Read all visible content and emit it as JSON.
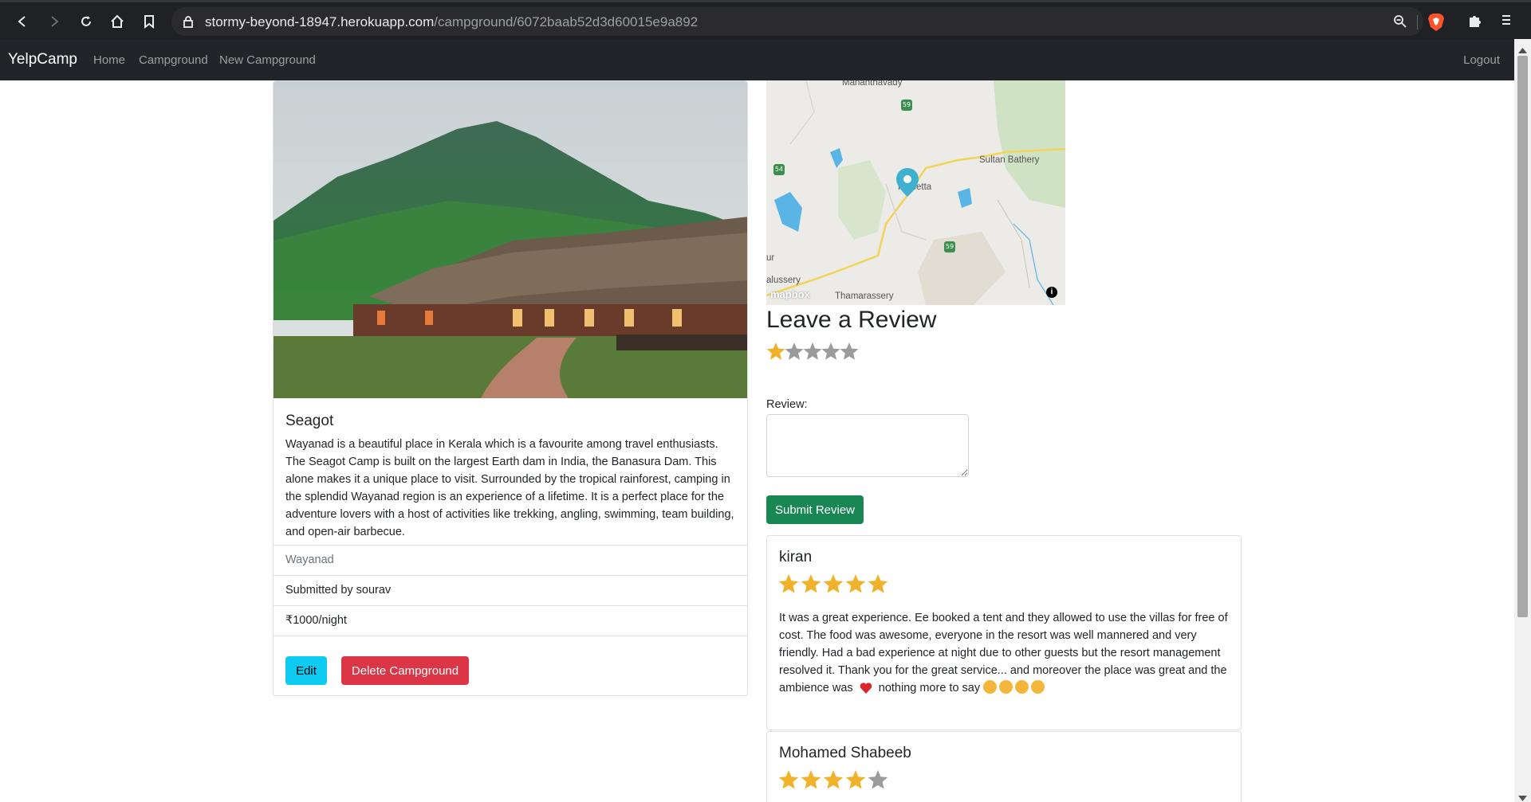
{
  "browser": {
    "url_host": "stormy-beyond-18947.herokuapp.com",
    "url_path": "/campground/6072baab52d3d60015e9a892"
  },
  "navbar": {
    "brand": "YelpCamp",
    "links": [
      "Home",
      "Campground",
      "New Campground"
    ],
    "logout": "Logout"
  },
  "campground": {
    "title": "Seagot",
    "description": "Wayanad is a beautiful place in Kerala which is a favourite among travel enthusiasts. The Seagot Camp is built on the largest Earth dam in India, the Banasura Dam. This alone makes it a unique place to visit. Surrounded by the tropical rainforest, camping in the splendid Wayanad region is an experience of a lifetime. It is a perfect place for the adventure lovers with a host of activities like trekking, angling, swimming, team building, and open-air barbecue.",
    "location": "Wayanad",
    "submitted_by": "Submitted by sourav",
    "price": "₹1000/night",
    "edit_label": "Edit",
    "delete_label": "Delete Campground"
  },
  "map": {
    "labels": [
      "Mananthavady",
      "Sultan Bathery",
      "Kalpetta",
      "ur",
      "alussery",
      "Thamarassery"
    ],
    "attribution": "mapbox",
    "route_shields": [
      "59",
      "54",
      "59"
    ]
  },
  "review_form": {
    "title": "Leave a Review",
    "selected_rating": 1,
    "max_rating": 5,
    "label": "Review:",
    "submit_label": "Submit Review"
  },
  "reviews": [
    {
      "author": "kiran",
      "rating": 5,
      "body_main": "It was a great experience. Ee booked a tent and they allowed to use the villas for free of cost. The food was awesome, everyone in the resort was well mannered and very friendly. Had a bad experience at night due to other guests but the resort management resolved it. Thank you for the great service... and moreover the place was great and the ambience was",
      "body_tail": "nothing more to say"
    },
    {
      "author": "Mohamed Shabeeb",
      "rating": 4
    }
  ],
  "colors": {
    "star_on": "#f1b22b",
    "star_off": "#9b9b9b",
    "edit": "#0dcaf0",
    "delete": "#dc3545",
    "submit": "#198754",
    "navbar": "#212529"
  }
}
